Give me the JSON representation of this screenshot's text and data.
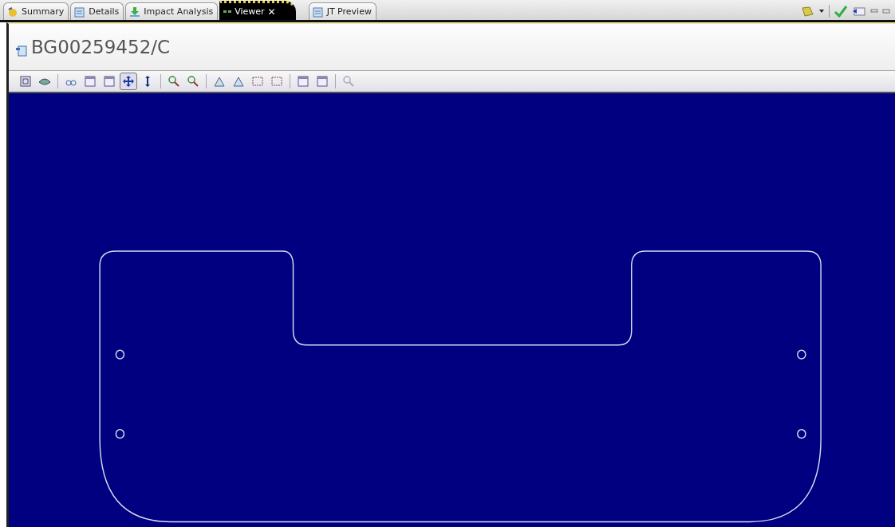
{
  "tabs": [
    {
      "label": "Summary",
      "selected": false,
      "closable": false
    },
    {
      "label": "Details",
      "selected": false,
      "closable": false
    },
    {
      "label": "Impact Analysis",
      "selected": false,
      "closable": false
    },
    {
      "label": "Viewer",
      "selected": true,
      "closable": true
    },
    {
      "label": "JT Preview",
      "selected": false,
      "closable": false
    }
  ],
  "close_glyph": "✕",
  "item": {
    "title": "BG00259452/C"
  },
  "toolbar": {
    "groups": [
      [
        {
          "selected": false
        },
        {
          "selected": false
        }
      ],
      [
        {
          "selected": false
        },
        {
          "selected": false
        },
        {
          "selected": false
        },
        {
          "selected": true
        },
        {
          "selected": false
        }
      ],
      [
        {
          "selected": false
        },
        {
          "selected": false
        }
      ],
      [
        {
          "selected": false
        },
        {
          "selected": false
        },
        {
          "selected": false
        },
        {
          "selected": false
        }
      ],
      [
        {
          "selected": false
        },
        {
          "selected": false
        }
      ],
      [
        {
          "selected": false
        }
      ]
    ]
  },
  "viewer": {
    "kind": "outline"
  }
}
